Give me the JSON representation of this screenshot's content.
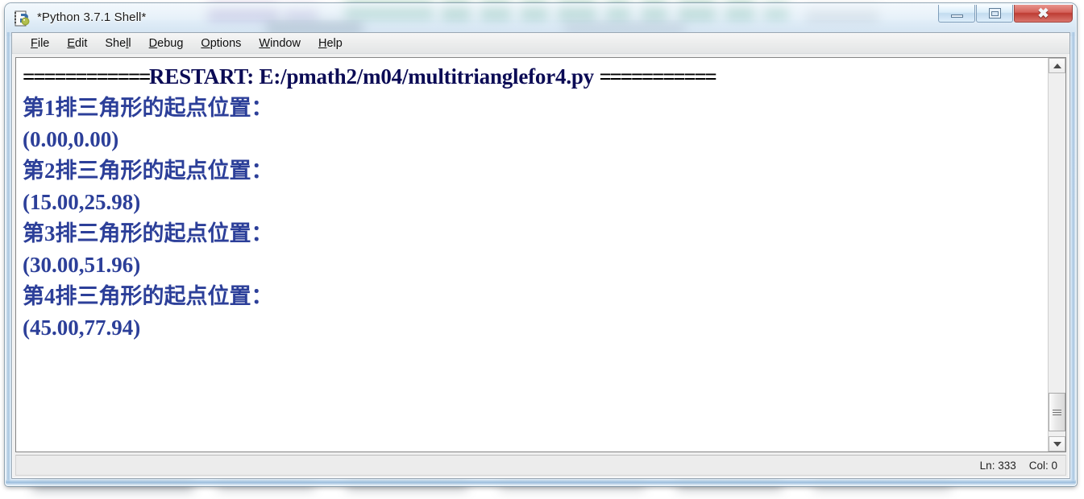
{
  "window": {
    "title": "*Python 3.7.1 Shell*",
    "icon": "idle-python-icon",
    "controls": {
      "minimize_label": "–",
      "maximize_label": "□",
      "close_label": "✕"
    }
  },
  "menubar": {
    "items": [
      {
        "label": "File",
        "mnemonic": "F"
      },
      {
        "label": "Edit",
        "mnemonic": "E"
      },
      {
        "label": "Shell",
        "mnemonic": "l"
      },
      {
        "label": "Debug",
        "mnemonic": "D"
      },
      {
        "label": "Options",
        "mnemonic": "O"
      },
      {
        "label": "Window",
        "mnemonic": "W"
      },
      {
        "label": "Help",
        "mnemonic": "H"
      }
    ]
  },
  "shell": {
    "restart_line": {
      "left_rule": "============",
      "text": "RESTART: E:/pmath2/m04/multitrianglefor4.py",
      "right_rule": "==========="
    },
    "output_lines": [
      "第1排三角形的起点位置：",
      "(0.00,0.00)",
      "第2排三角形的起点位置：",
      "(15.00,25.98)",
      "第3排三角形的起点位置：",
      "(30.00,51.96)",
      "第4排三角形的起点位置：",
      "(45.00,77.94)"
    ],
    "output_color": "#2c3f99",
    "restart_color": "#000000"
  },
  "scrollbar": {
    "up_arrow": "scroll-up-arrow",
    "down_arrow": "scroll-down-arrow"
  },
  "statusbar": {
    "line_label": "Ln: 333",
    "col_label": "Col: 0"
  }
}
